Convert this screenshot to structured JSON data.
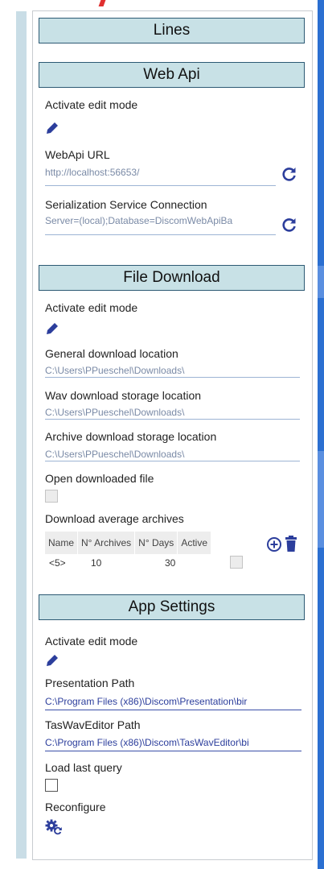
{
  "header_lines": "Lines",
  "web_api": {
    "title": "Web Api",
    "edit_mode_label": "Activate edit mode",
    "url_label": "WebApi URL",
    "url_value": "http://localhost:56653/",
    "serialization_label": "Serialization Service Connection",
    "serialization_value": "Server=(local);Database=DiscomWebApiBa"
  },
  "file_download": {
    "title": "File Download",
    "edit_mode_label": "Activate edit mode",
    "general_label": "General download location",
    "general_value": "C:\\Users\\PPueschel\\Downloads\\",
    "wav_label": "Wav download storage location",
    "wav_value": "C:\\Users\\PPueschel\\Downloads\\",
    "archive_label": "Archive download storage location",
    "archive_value": "C:\\Users\\PPueschel\\Downloads\\",
    "open_label": "Open downloaded file",
    "avg_label": "Download average archives",
    "table": {
      "headers": [
        "Name",
        "N° Archives",
        "N° Days",
        "Active"
      ],
      "row": {
        "name": "<5>",
        "archives": "10",
        "days": "30"
      }
    }
  },
  "app_settings": {
    "title": "App Settings",
    "edit_mode_label": "Activate edit mode",
    "presentation_label": "Presentation Path",
    "presentation_value": "C:\\Program Files (x86)\\Discom\\Presentation\\bir",
    "taswav_label": "TasWavEditor Path",
    "taswav_value": "C:\\Program Files (x86)\\Discom\\TasWavEditor\\bi",
    "load_last_label": "Load last query",
    "reconfigure_label": "Reconfigure"
  },
  "colors": {
    "accent": "#2c3e9c",
    "header_bg": "#c8e1e6",
    "header_border": "#2d5a74"
  }
}
